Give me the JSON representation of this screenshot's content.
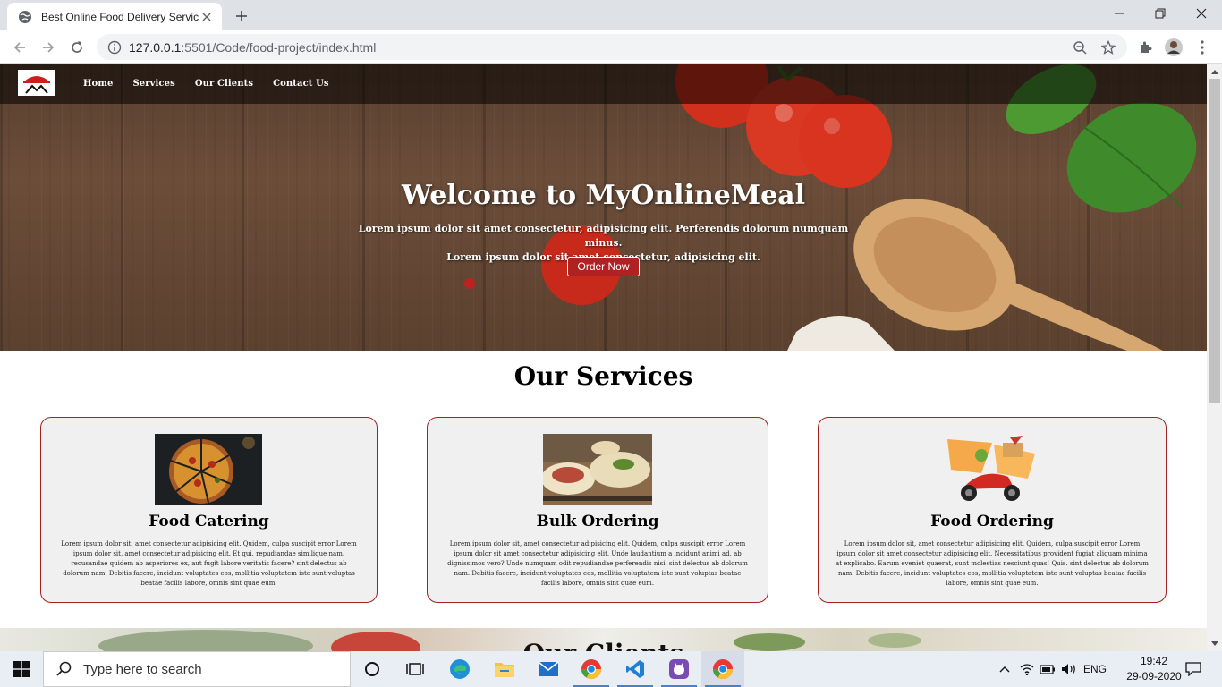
{
  "browser": {
    "tab_title": "Best Online Food Delivery Service",
    "url_host": "127.0.0.1",
    "url_path": ":5501/Code/food-project/index.html"
  },
  "nav": {
    "items": [
      {
        "label": "Home"
      },
      {
        "label": "Services"
      },
      {
        "label": "Our Clients"
      },
      {
        "label": "Contact Us"
      }
    ]
  },
  "hero": {
    "title": "Welcome to MyOnlineMeal",
    "subtitle_line1": "Lorem ipsum dolor sit amet consectetur, adipisicing elit. Perferendis dolorum numquam minus.",
    "subtitle_line2": "Lorem ipsum dolor sit amet consectetur, adipisicing elit.",
    "button": "Order Now"
  },
  "services": {
    "title": "Our Services",
    "cards": [
      {
        "title": "Food Catering",
        "text": "Lorem ipsum dolor sit, amet consectetur adipisicing elit. Quidem, culpa suscipit error Lorem ipsum dolor sit, amet consectetur adipisicing elit. Et qui, repudiandae similique nam, recusandae quidem ab asperiores ex, aut fugit labore veritatis facere? sint delectus ab dolorum nam. Debitis facere, incidunt voluptates eos, mollitia voluptatem iste sunt voluptas beatae facilis labore, omnis sint quae eum."
      },
      {
        "title": "Bulk Ordering",
        "text": "Lorem ipsum dolor sit, amet consectetur adipisicing elit. Quidem, culpa suscipit error Lorem ipsum dolor sit amet consectetur adipisicing elit. Unde laudantium a incidunt animi ad, ab dignissimos vero? Unde numquam odit repudiandae perferendis nisi. sint delectus ab dolorum nam. Debitis facere, incidunt voluptates eos, mollitia voluptatem iste sunt voluptas beatae facilis labore, omnis sint quae eum."
      },
      {
        "title": "Food Ordering",
        "text": "Lorem ipsum dolor sit, amet consectetur adipisicing elit. Quidem, culpa suscipit error Lorem ipsum dolor sit amet consectetur adipisicing elit. Necessitatibus provident fugiat aliquam minima at explicabo. Earum eveniet quaerat, sunt molestias nesciunt quas! Quis. sint delectus ab dolorum nam. Debitis facere, incidunt voluptates eos, mollitia voluptatem iste sunt voluptas beatae facilis labore, omnis sint quae eum."
      }
    ]
  },
  "clients": {
    "title": "Our Clients"
  },
  "taskbar": {
    "search_placeholder": "Type here to search",
    "language": "ENG",
    "time": "19:42",
    "date": "29-09-2020"
  },
  "colors": {
    "accent": "#b02121",
    "card_border": "#a12121",
    "card_bg": "#f0f0f0"
  }
}
